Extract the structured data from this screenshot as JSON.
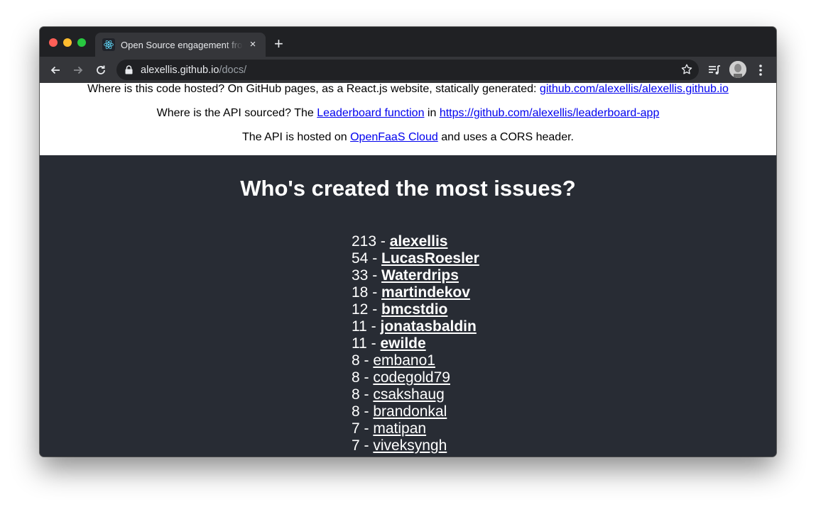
{
  "browser": {
    "tab_title": "Open Source engagement from",
    "tab_close": "×",
    "new_tab": "+",
    "url_host": "alexellis.github.io",
    "url_path": "/docs/"
  },
  "info": {
    "line1_text": "Where is this code hosted? On GitHub pages, as a React.js website, statically generated: ",
    "line1_link": "github.com/alexellis/alexellis.github.io",
    "line2_text": "Where is the API sourced? The ",
    "line2_link1": "Leaderboard function",
    "line2_mid": " in ",
    "line2_link2": "https://github.com/alexellis/leaderboard-app",
    "line3_text": "The API is hosted on ",
    "line3_link": "OpenFaaS Cloud",
    "line3_tail": " and uses a CORS header."
  },
  "leaderboard": {
    "heading": "Who's created the most issues?",
    "entries": [
      {
        "count": "213",
        "user": "alexellis"
      },
      {
        "count": "54",
        "user": "LucasRoesler"
      },
      {
        "count": "33",
        "user": "Waterdrips"
      },
      {
        "count": "18",
        "user": "martindekov"
      },
      {
        "count": "12",
        "user": "bmcstdio"
      },
      {
        "count": "11",
        "user": "jonatasbaldin"
      },
      {
        "count": "11",
        "user": "ewilde"
      },
      {
        "count": "8",
        "user": "embano1"
      },
      {
        "count": "8",
        "user": "codegold79"
      },
      {
        "count": "8",
        "user": "csakshaug"
      },
      {
        "count": "8",
        "user": "brandonkal"
      },
      {
        "count": "7",
        "user": "matipan"
      },
      {
        "count": "7",
        "user": "viveksyngh"
      }
    ]
  },
  "colors": {
    "dark_bg": "#282c34",
    "link": "#0000ee",
    "chrome_titlebar": "#202124",
    "chrome_toolbar": "#35363a"
  },
  "icons": [
    "react-favicon-icon",
    "back-icon",
    "forward-icon",
    "reload-icon",
    "lock-icon",
    "star-icon",
    "media-queue-icon",
    "avatar",
    "more-menu-icon"
  ]
}
